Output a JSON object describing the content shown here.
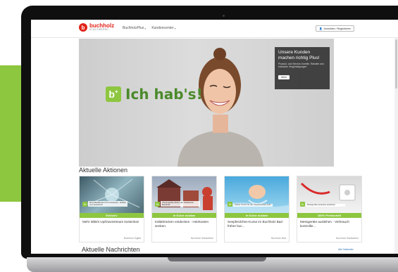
{
  "header": {
    "logo_name": "buchholz",
    "logo_sub": "STADTWERKE",
    "nav": [
      "BuchholzPlus",
      "Kundencenter"
    ],
    "login_label": "Anmelden / Registrieren"
  },
  "hero": {
    "badge": "b",
    "badge_sup": "+",
    "slogan": "Ich hab's!",
    "promo_title": "Unsere Kunden machen richtig Plus!",
    "promo_text": "Produkt- und Service-Vorteile, Rabatte und exklusive Vergünstigungen",
    "promo_button": "Mehr"
  },
  "actions": {
    "title": "Aktuelle Aktionen",
    "cards": [
      {
        "badge": "Exklusiv",
        "text": "Mehr Mbit/s Up/Downstream kostenlos!",
        "source": "Buchholz Digital",
        "caption": "Mehr Bandbreite für Ihr Zuhause - einfach zum Geschenk"
      },
      {
        "badge": "In Kürze nutzbar",
        "text": "Kältebrücken entdecken - Heizkosten senken.",
        "source": "Buchholz Stadtwerke",
        "caption": "Thermografie-Aktion der Stadtwerke Buchholz"
      },
      {
        "badge": "In Kürze nutzbar",
        "text": "Seepferdchen-Kurse im Buchholz Bad früher buc...",
        "source": "Buchholz Bad",
        "caption": "Früher Termin für den Seepferdchen-Kurs"
      },
      {
        "badge": "100% Preisvorteil",
        "text": "Messgeräte ausleihen - Verbrauch kontrollie...",
        "source": "Buchholz Stadtwerke",
        "caption": "Messgeräte kostenlos ausleihen"
      }
    ]
  },
  "news": {
    "title": "Aktuelle Nachrichten",
    "all_link": "Alle Nabenter"
  },
  "colors": {
    "brand_green": "#8dc63f",
    "brand_red": "#e2231a",
    "promo_box": "#282828"
  }
}
